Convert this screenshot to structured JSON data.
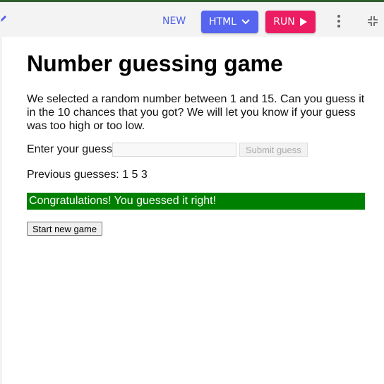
{
  "toolbar": {
    "new_label": "NEW",
    "html_label": "HTML",
    "run_label": "RUN",
    "colors": {
      "html_button": "#5565ef",
      "run_button": "#ec1c63",
      "accent_text": "#5061e8"
    }
  },
  "game": {
    "title": "Number guessing game",
    "intro": "We selected a random number between 1 and 15. Can you guess it in the 10 chances that you got? We will let you know if your guess was too high or too low.",
    "guess_label": "Enter your guess",
    "guess_value": "",
    "submit_label": "Submit guess",
    "previous_guesses": "Previous guesses: 1 5 3",
    "result_message": "Congratulations! You guessed it right!",
    "result_color": "#008000",
    "new_game_label": "Start new game"
  }
}
